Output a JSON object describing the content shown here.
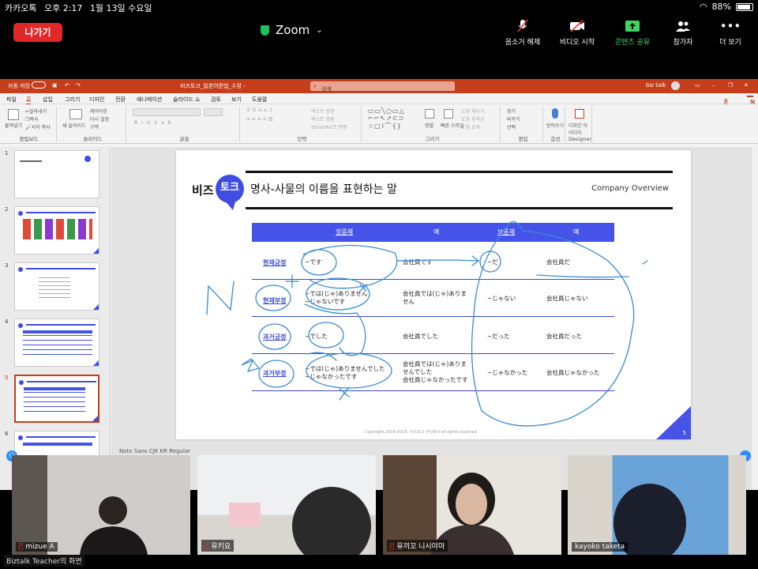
{
  "status_bar": {
    "carrier": "카카오톡",
    "time": "오후 2:17",
    "date": "1월 13일 수요일",
    "battery": "88%",
    "battery_level": 0.88
  },
  "zoom": {
    "leave_label": "나가기",
    "title": "Zoom",
    "toolbar": [
      {
        "id": "mute",
        "label": "음소거 해제",
        "icon": "mic-off-icon"
      },
      {
        "id": "video",
        "label": "비디오 시작",
        "icon": "video-off-icon"
      },
      {
        "id": "share",
        "label": "콘텐츠 공유",
        "icon": "share-screen-icon"
      },
      {
        "id": "participants",
        "label": "참가자",
        "icon": "participants-icon"
      },
      {
        "id": "more",
        "label": "더 보기",
        "icon": "more-icon"
      }
    ]
  },
  "ppt": {
    "autosave": "자동 저장",
    "filename": "비즈토크_일본어문법_수정 -",
    "search": "검색",
    "user": "biz talk",
    "menu": [
      "파일",
      "홈",
      "삽입",
      "그리기",
      "디자인",
      "전환",
      "애니메이션",
      "슬라이드 쇼",
      "검토",
      "보기",
      "도움말"
    ],
    "active_menu": "홈",
    "share": "공유",
    "memo": "메모",
    "ribbon": {
      "groups": [
        "클립보드",
        "슬라이드",
        "글꼴",
        "단락",
        "그리기",
        "편집",
        "음성",
        "Designer"
      ],
      "paste": "붙여넣기",
      "cut": "잘라내기",
      "copy": "복사",
      "format_painter": "서식 복사",
      "new_slide": "새 슬라이드",
      "layout": "레이아웃",
      "reset": "다시 설정",
      "section": "구역",
      "text_direction": "텍스트 방향",
      "align_text": "텍스트 맞춤",
      "smartart": "SmartArt로 변환",
      "arrange": "정렬",
      "quick_styles": "빠른 스타일",
      "shape_fill": "도형 채우기",
      "shape_outline": "도형 윤곽선",
      "shape_effects": "도형 효과",
      "find": "찾기",
      "replace": "바꾸기",
      "select": "선택",
      "dictate": "받아쓰기",
      "design_ideas": "디자인 아이디어"
    },
    "thumbnails": [
      "1",
      "2",
      "3",
      "4",
      "5",
      "6"
    ],
    "selected_thumbnail": "5",
    "font_status": "Noto Sans CJK KR Regular"
  },
  "slide": {
    "logo_text": "비즈",
    "logo_bubble": "토크",
    "title": "명사-사물의 이름을 표현하는 말",
    "company": "Company Overview",
    "headers": [
      "정중체",
      "예",
      "보통체",
      "예"
    ],
    "rows": [
      {
        "label": "현재긍정",
        "polite": "~です",
        "polite_ex": "会社員です",
        "plain": "~だ",
        "plain_ex": "会社員だ"
      },
      {
        "label": "현재부정",
        "polite": "~では(じゃ)ありません\n~じゃないです",
        "polite_ex": "会社員では(じゃ)ありま\nせん",
        "plain": "~じゃない",
        "plain_ex": "会社員じゃない"
      },
      {
        "label": "과거긍정",
        "polite": "~でした",
        "polite_ex": "会社員でした",
        "plain": "~だった",
        "plain_ex": "会社員だった"
      },
      {
        "label": "과거부정",
        "polite": "~では(じゃ)ありませんでした\n~じゃなかったです",
        "polite_ex": "会社員では(じゃ)ありま\nせんでした\n会社員じゃなかったです",
        "plain": "~じゃなかった",
        "plain_ex": "会社員じゃなかった"
      }
    ],
    "copyright": "Copyright 2016-2019, 비즈토크 주식회사 all rights reserved.",
    "page": "5"
  },
  "participants": [
    {
      "name": "mizue A",
      "muted": true
    },
    {
      "name": "유키요",
      "muted": true
    },
    {
      "name": "유끼꼬 니시야마",
      "muted": true
    },
    {
      "name": "kayoko taketa",
      "muted": false
    }
  ],
  "sharer_label": "Biztalk Teacher의 화면",
  "colors": {
    "accent": "#3f4de0",
    "ppt_red": "#c43e1c",
    "leave_red": "#e02828",
    "share_green": "#3ed660",
    "ink_blue": "#3b8bd1"
  }
}
